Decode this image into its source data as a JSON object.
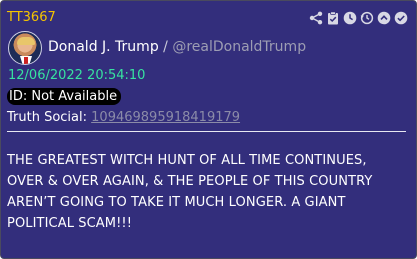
{
  "post": {
    "id": "TT3667",
    "author_name": "Donald J. Trump",
    "separator": "/",
    "handle": "@realDonaldTrump",
    "timestamp": "12/06/2022 20:54:10",
    "id_badge": "ID: Not Available",
    "truth_social_label": "Truth Social:",
    "truth_social_id": "109469895918419179",
    "text": "THE GREATEST WITCH HUNT OF ALL TIME CONTINUES, OVER & OVER AGAIN, & THE PEOPLE OF THIS COUNTRY AREN’T GOING TO TAKE IT MUCH LONGER. A GIANT POLITICAL SCAM!!!"
  },
  "toolbar": {
    "icons": [
      "share-icon",
      "clipboard-check-icon",
      "clock-icon",
      "history-icon",
      "chevron-up-circle-icon",
      "check-circle-icon"
    ]
  },
  "colors": {
    "card_bg": "#332e7c",
    "post_id": "#f5c400",
    "timestamp": "#37e3a0",
    "handle": "#9d9db3",
    "link": "#8b8ba8"
  }
}
